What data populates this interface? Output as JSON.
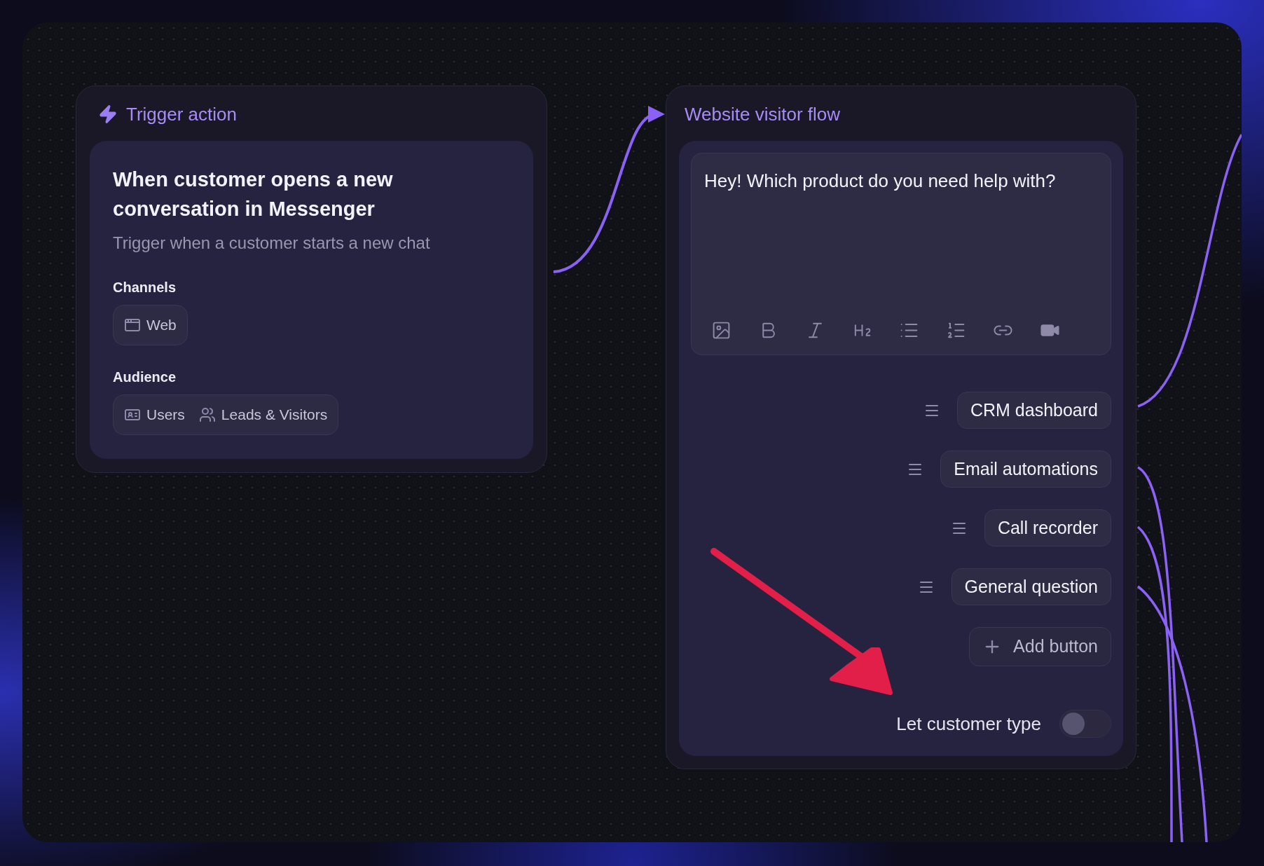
{
  "trigger": {
    "title": "Trigger action",
    "heading": "When customer opens a new conversation in Messenger",
    "description": "Trigger when a customer starts a new chat",
    "channels": {
      "label": "Channels",
      "items": [
        {
          "label": "Web"
        }
      ]
    },
    "audience": {
      "label": "Audience",
      "items": [
        {
          "label": "Users"
        },
        {
          "label": "Leads & Visitors"
        }
      ]
    }
  },
  "flow": {
    "title": "Website visitor flow",
    "message": "Hey! Which product do you need help with?",
    "buttons": [
      {
        "label": "CRM dashboard"
      },
      {
        "label": "Email automations"
      },
      {
        "label": "Call recorder"
      },
      {
        "label": "General question"
      }
    ],
    "add_button": "Add button",
    "toggle": {
      "label": "Let customer type",
      "on": false
    }
  }
}
